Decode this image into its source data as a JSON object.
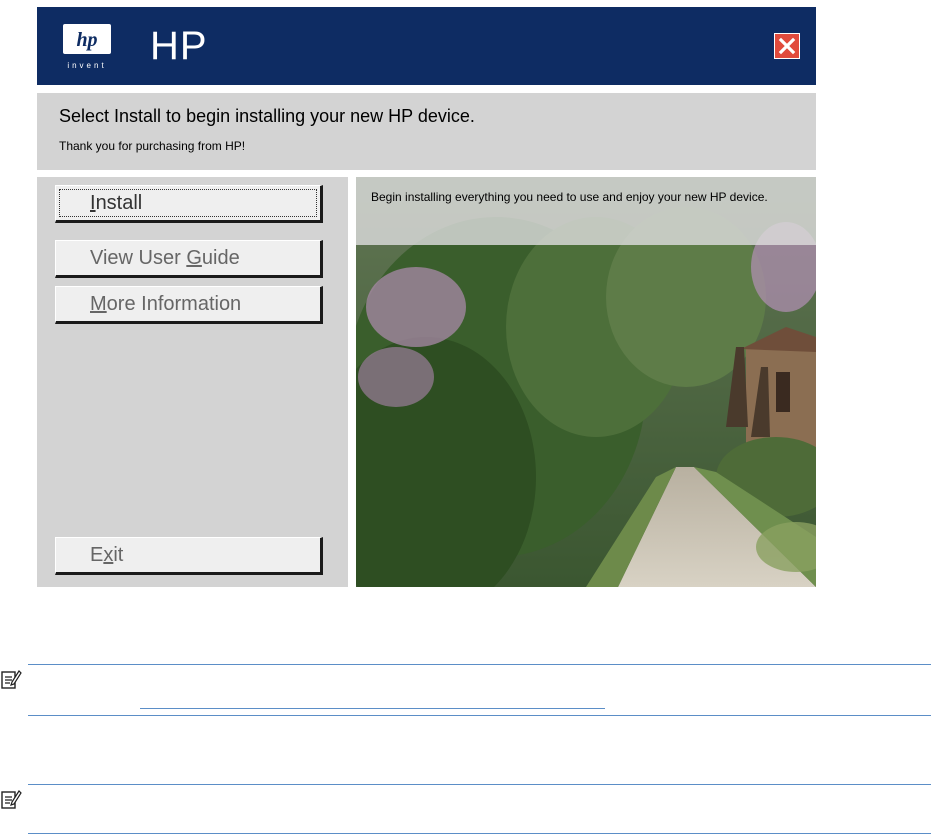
{
  "window": {
    "title": "HP",
    "logo_label": "invent",
    "close_icon": "close-icon"
  },
  "banner": {
    "heading": "Select Install to begin installing your new HP device.",
    "subheading": "Thank you for purchasing from HP!"
  },
  "menu": {
    "install_pre": "",
    "install_u": "I",
    "install_post": "nstall",
    "guide_pre": "View User ",
    "guide_u": "G",
    "guide_post": "uide",
    "more_pre": "",
    "more_u": "M",
    "more_post": "ore Information",
    "exit_pre": "E",
    "exit_u": "x",
    "exit_post": "it"
  },
  "description": "Begin installing everything you need to use and enjoy your new HP device.",
  "notes": [
    {
      "icon": "note-icon"
    },
    {
      "icon": "note-icon"
    }
  ]
}
